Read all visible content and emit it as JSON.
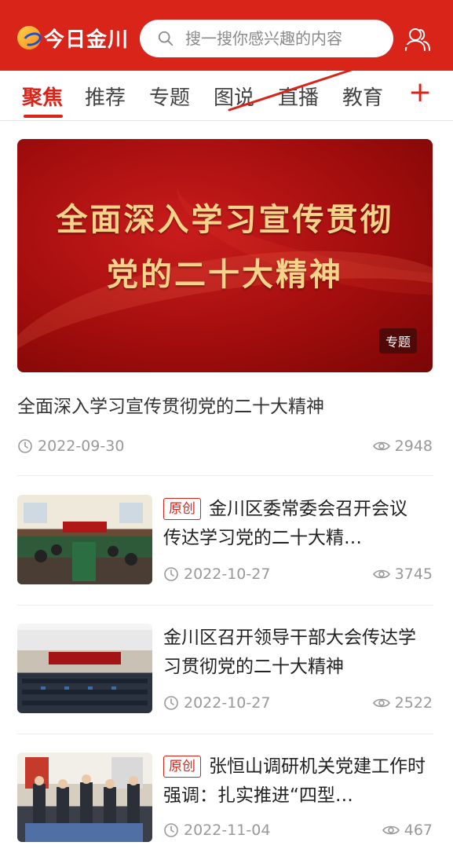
{
  "header": {
    "logo_text": "今日金川",
    "search_placeholder": "搜一搜你感兴趣的内容"
  },
  "tabs": [
    {
      "label": "聚焦",
      "active": true
    },
    {
      "label": "推荐",
      "active": false
    },
    {
      "label": "专题",
      "active": false
    },
    {
      "label": "图说",
      "active": false
    },
    {
      "label": "直播",
      "active": false
    },
    {
      "label": "教育",
      "active": false
    }
  ],
  "tab_add_label": "+",
  "featured": {
    "banner_line1": "全面深入学习宣传贯彻",
    "banner_line2": "党的二十大精神",
    "badge": "专题",
    "title": "全面深入学习宣传贯彻党的二十大精神",
    "date": "2022-09-30",
    "views": "2948"
  },
  "articles": [
    {
      "tag": "原创",
      "title": "金川区委常委会召开会议 传达学习党的二十大精…",
      "date": "2022-10-27",
      "views": "3745"
    },
    {
      "tag": "",
      "title": "金川区召开领导干部大会传达学习贯彻党的二十大精神",
      "date": "2022-10-27",
      "views": "2522"
    },
    {
      "tag": "原创",
      "title": "张恒山调研机关党建工作时强调：扎实推进“四型…",
      "date": "2022-11-04",
      "views": "467"
    }
  ],
  "colors": {
    "brand_red": "#d9241a",
    "banner_gold": "#f6d38a",
    "meta_gray": "#999999"
  },
  "icons": [
    "search-icon",
    "user-icon",
    "clock-icon",
    "eye-icon",
    "plus-icon"
  ]
}
